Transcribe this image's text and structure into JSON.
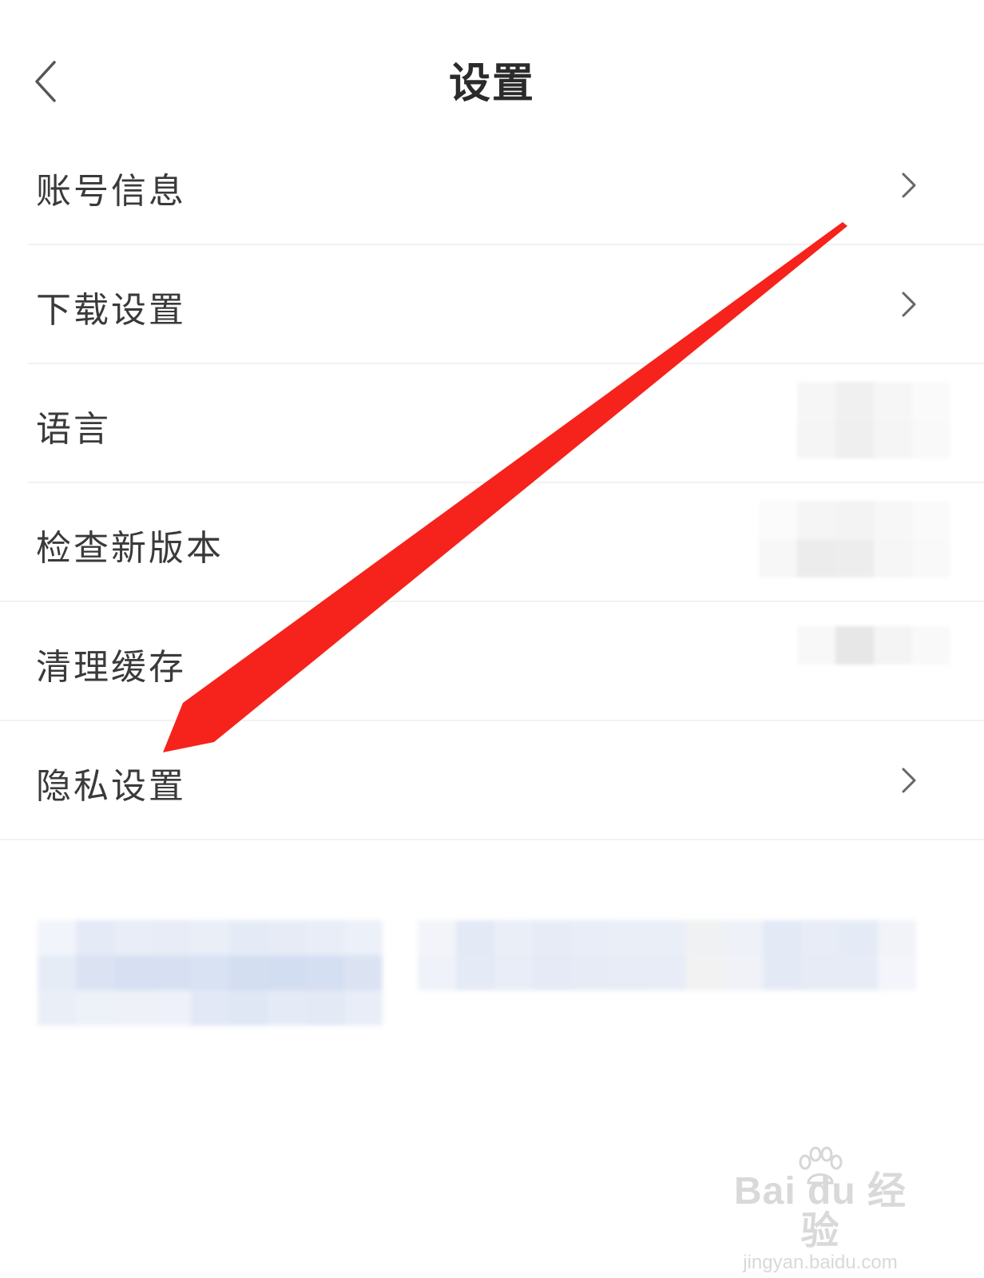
{
  "header": {
    "title": "设置"
  },
  "menu": {
    "items": [
      {
        "label": "账号信息",
        "has_chevron": true
      },
      {
        "label": "下载设置",
        "has_chevron": true
      },
      {
        "label": "语言",
        "has_chevron": false
      },
      {
        "label": "检查新版本",
        "has_chevron": false
      },
      {
        "label": "清理缓存",
        "has_chevron": false
      },
      {
        "label": "隐私设置",
        "has_chevron": true
      }
    ]
  },
  "icons": {
    "back": "chevron-left-icon",
    "row_arrow": "chevron-right-icon"
  },
  "annotation": {
    "arrow_color": "#f5231b",
    "points_to": "隐私设置"
  },
  "watermark": {
    "line1": "Bai du 经验",
    "line2": "jingyan.baidu.com"
  },
  "colors": {
    "background": "#ffffff",
    "text": "#3a3a3a",
    "divider": "#f1f1f1",
    "blurred_footer": "#dfe6f4"
  }
}
